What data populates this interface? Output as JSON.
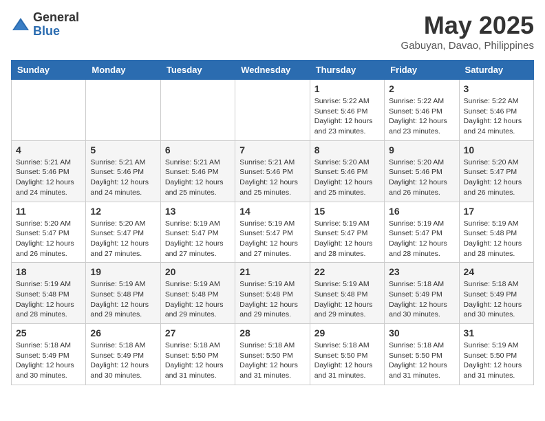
{
  "logo": {
    "general": "General",
    "blue": "Blue"
  },
  "title": "May 2025",
  "location": "Gabuyan, Davao, Philippines",
  "days_of_week": [
    "Sunday",
    "Monday",
    "Tuesday",
    "Wednesday",
    "Thursday",
    "Friday",
    "Saturday"
  ],
  "weeks": [
    [
      {
        "day": "",
        "info": ""
      },
      {
        "day": "",
        "info": ""
      },
      {
        "day": "",
        "info": ""
      },
      {
        "day": "",
        "info": ""
      },
      {
        "day": "1",
        "info": "Sunrise: 5:22 AM\nSunset: 5:46 PM\nDaylight: 12 hours\nand 23 minutes."
      },
      {
        "day": "2",
        "info": "Sunrise: 5:22 AM\nSunset: 5:46 PM\nDaylight: 12 hours\nand 23 minutes."
      },
      {
        "day": "3",
        "info": "Sunrise: 5:22 AM\nSunset: 5:46 PM\nDaylight: 12 hours\nand 24 minutes."
      }
    ],
    [
      {
        "day": "4",
        "info": "Sunrise: 5:21 AM\nSunset: 5:46 PM\nDaylight: 12 hours\nand 24 minutes."
      },
      {
        "day": "5",
        "info": "Sunrise: 5:21 AM\nSunset: 5:46 PM\nDaylight: 12 hours\nand 24 minutes."
      },
      {
        "day": "6",
        "info": "Sunrise: 5:21 AM\nSunset: 5:46 PM\nDaylight: 12 hours\nand 25 minutes."
      },
      {
        "day": "7",
        "info": "Sunrise: 5:21 AM\nSunset: 5:46 PM\nDaylight: 12 hours\nand 25 minutes."
      },
      {
        "day": "8",
        "info": "Sunrise: 5:20 AM\nSunset: 5:46 PM\nDaylight: 12 hours\nand 25 minutes."
      },
      {
        "day": "9",
        "info": "Sunrise: 5:20 AM\nSunset: 5:46 PM\nDaylight: 12 hours\nand 26 minutes."
      },
      {
        "day": "10",
        "info": "Sunrise: 5:20 AM\nSunset: 5:47 PM\nDaylight: 12 hours\nand 26 minutes."
      }
    ],
    [
      {
        "day": "11",
        "info": "Sunrise: 5:20 AM\nSunset: 5:47 PM\nDaylight: 12 hours\nand 26 minutes."
      },
      {
        "day": "12",
        "info": "Sunrise: 5:20 AM\nSunset: 5:47 PM\nDaylight: 12 hours\nand 27 minutes."
      },
      {
        "day": "13",
        "info": "Sunrise: 5:19 AM\nSunset: 5:47 PM\nDaylight: 12 hours\nand 27 minutes."
      },
      {
        "day": "14",
        "info": "Sunrise: 5:19 AM\nSunset: 5:47 PM\nDaylight: 12 hours\nand 27 minutes."
      },
      {
        "day": "15",
        "info": "Sunrise: 5:19 AM\nSunset: 5:47 PM\nDaylight: 12 hours\nand 28 minutes."
      },
      {
        "day": "16",
        "info": "Sunrise: 5:19 AM\nSunset: 5:47 PM\nDaylight: 12 hours\nand 28 minutes."
      },
      {
        "day": "17",
        "info": "Sunrise: 5:19 AM\nSunset: 5:48 PM\nDaylight: 12 hours\nand 28 minutes."
      }
    ],
    [
      {
        "day": "18",
        "info": "Sunrise: 5:19 AM\nSunset: 5:48 PM\nDaylight: 12 hours\nand 28 minutes."
      },
      {
        "day": "19",
        "info": "Sunrise: 5:19 AM\nSunset: 5:48 PM\nDaylight: 12 hours\nand 29 minutes."
      },
      {
        "day": "20",
        "info": "Sunrise: 5:19 AM\nSunset: 5:48 PM\nDaylight: 12 hours\nand 29 minutes."
      },
      {
        "day": "21",
        "info": "Sunrise: 5:19 AM\nSunset: 5:48 PM\nDaylight: 12 hours\nand 29 minutes."
      },
      {
        "day": "22",
        "info": "Sunrise: 5:19 AM\nSunset: 5:48 PM\nDaylight: 12 hours\nand 29 minutes."
      },
      {
        "day": "23",
        "info": "Sunrise: 5:18 AM\nSunset: 5:49 PM\nDaylight: 12 hours\nand 30 minutes."
      },
      {
        "day": "24",
        "info": "Sunrise: 5:18 AM\nSunset: 5:49 PM\nDaylight: 12 hours\nand 30 minutes."
      }
    ],
    [
      {
        "day": "25",
        "info": "Sunrise: 5:18 AM\nSunset: 5:49 PM\nDaylight: 12 hours\nand 30 minutes."
      },
      {
        "day": "26",
        "info": "Sunrise: 5:18 AM\nSunset: 5:49 PM\nDaylight: 12 hours\nand 30 minutes."
      },
      {
        "day": "27",
        "info": "Sunrise: 5:18 AM\nSunset: 5:50 PM\nDaylight: 12 hours\nand 31 minutes."
      },
      {
        "day": "28",
        "info": "Sunrise: 5:18 AM\nSunset: 5:50 PM\nDaylight: 12 hours\nand 31 minutes."
      },
      {
        "day": "29",
        "info": "Sunrise: 5:18 AM\nSunset: 5:50 PM\nDaylight: 12 hours\nand 31 minutes."
      },
      {
        "day": "30",
        "info": "Sunrise: 5:18 AM\nSunset: 5:50 PM\nDaylight: 12 hours\nand 31 minutes."
      },
      {
        "day": "31",
        "info": "Sunrise: 5:19 AM\nSunset: 5:50 PM\nDaylight: 12 hours\nand 31 minutes."
      }
    ]
  ]
}
